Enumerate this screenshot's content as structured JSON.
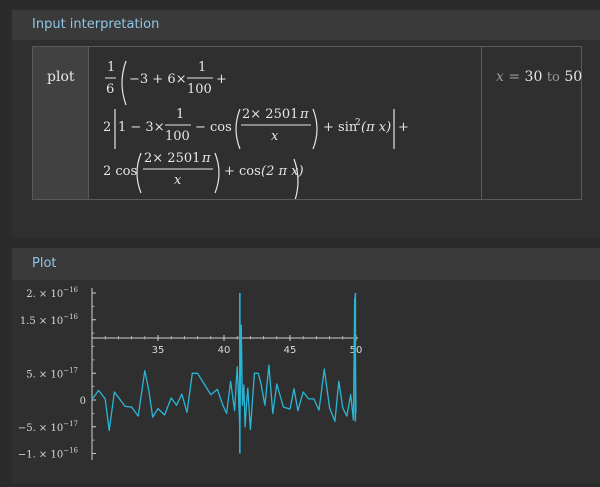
{
  "sections": {
    "input_title": "Input interpretation",
    "plot_title": "Plot"
  },
  "interpretation": {
    "command": "plot",
    "variable": "x",
    "equals": "=",
    "range_start": "30",
    "range_word": "to",
    "range_end": "50",
    "math": {
      "frac_one": "1",
      "frac_six": "6",
      "minus_three": "−3 + 6×",
      "one": "1",
      "hundred": "100",
      "plus": "+",
      "two": "2",
      "inner_start": "1 − 3×",
      "minus_cos": "− cos",
      "two_times": "2× 2501",
      "pi": "π",
      "x": "x",
      "plus_sin": "+ sin",
      "sup2": "2",
      "pix": "(π x)",
      "two_cos": "2 cos",
      "plus_cos": "+ cos",
      "two_pi_x": "(2 π x)"
    }
  },
  "chart_data": {
    "type": "line",
    "color": "#29b6d6",
    "xlim": [
      30,
      50
    ],
    "ylim": [
      -1.1e-16,
      2.1e-16
    ],
    "x_ticks": [
      {
        "value": 35,
        "label": "35"
      },
      {
        "value": 40,
        "label": "40"
      },
      {
        "value": 45,
        "label": "45"
      },
      {
        "value": 50,
        "label": "50"
      }
    ],
    "y_ticks": [
      {
        "value": 2e-16,
        "mantissa": "2. × 10",
        "exp": "−16"
      },
      {
        "value": 1.5e-16,
        "mantissa": "1.5 × 10",
        "exp": "−16"
      },
      {
        "value": 5e-17,
        "mantissa": "5. × 10",
        "exp": "−17"
      },
      {
        "value": 0,
        "mantissa": "0",
        "exp": ""
      },
      {
        "value": -5e-17,
        "mantissa": "−5. × 10",
        "exp": "−17"
      },
      {
        "value": -1e-16,
        "mantissa": "−1. × 10",
        "exp": "−16"
      }
    ],
    "x": [
      30.0,
      30.5,
      31.0,
      31.3,
      31.7,
      32.0,
      32.5,
      33.0,
      33.5,
      34.0,
      34.3,
      34.6,
      35.0,
      35.5,
      36.0,
      36.4,
      36.8,
      37.2,
      37.6,
      38.0,
      38.5,
      39.0,
      39.5,
      39.9,
      40.2,
      40.5,
      40.8,
      41.0,
      41.1,
      41.2,
      41.3,
      41.4,
      41.5,
      41.6,
      41.7,
      41.8,
      42.0,
      42.3,
      42.6,
      42.8,
      43.1,
      43.4,
      43.7,
      44.0,
      44.5,
      45.0,
      45.3,
      45.6,
      46.0,
      46.4,
      46.8,
      47.2,
      47.6,
      48.0,
      48.4,
      48.7,
      49.0,
      49.3,
      49.6,
      49.8,
      49.9,
      50.0
    ],
    "y": [
      1e-18,
      1.8e-17,
      2e-18,
      -5.7e-17,
      1.5e-17,
      5e-18,
      -1.2e-17,
      -1.3e-17,
      -3e-17,
      5.5e-17,
      1.8e-17,
      -3.2e-17,
      -1.6e-17,
      -2.8e-17,
      4e-18,
      -1e-17,
      1.1e-17,
      -2.3e-17,
      5e-17,
      5e-17,
      3e-17,
      1e-17,
      2e-17,
      -9e-18,
      -2.5e-17,
      3.5e-17,
      -2e-17,
      6.2e-17,
      1e-17,
      -5.5e-17,
      1.4e-16,
      -1e-17,
      2.8e-17,
      -5e-17,
      -1e-17,
      2.2e-17,
      -5.5e-17,
      5e-17,
      5e-17,
      3e-17,
      -1e-17,
      6.5e-17,
      -2.5e-17,
      3e-17,
      -1.3e-17,
      -1.7e-17,
      2.1e-17,
      -2e-17,
      1.5e-17,
      2e-18,
      2e-18,
      -1.9e-17,
      5.8e-17,
      -1.5e-17,
      -4e-17,
      3.5e-17,
      -1.5e-17,
      -3e-17,
      1e-17,
      -3.7e-17,
      1.9e-16,
      -2.4e-17
    ]
  }
}
